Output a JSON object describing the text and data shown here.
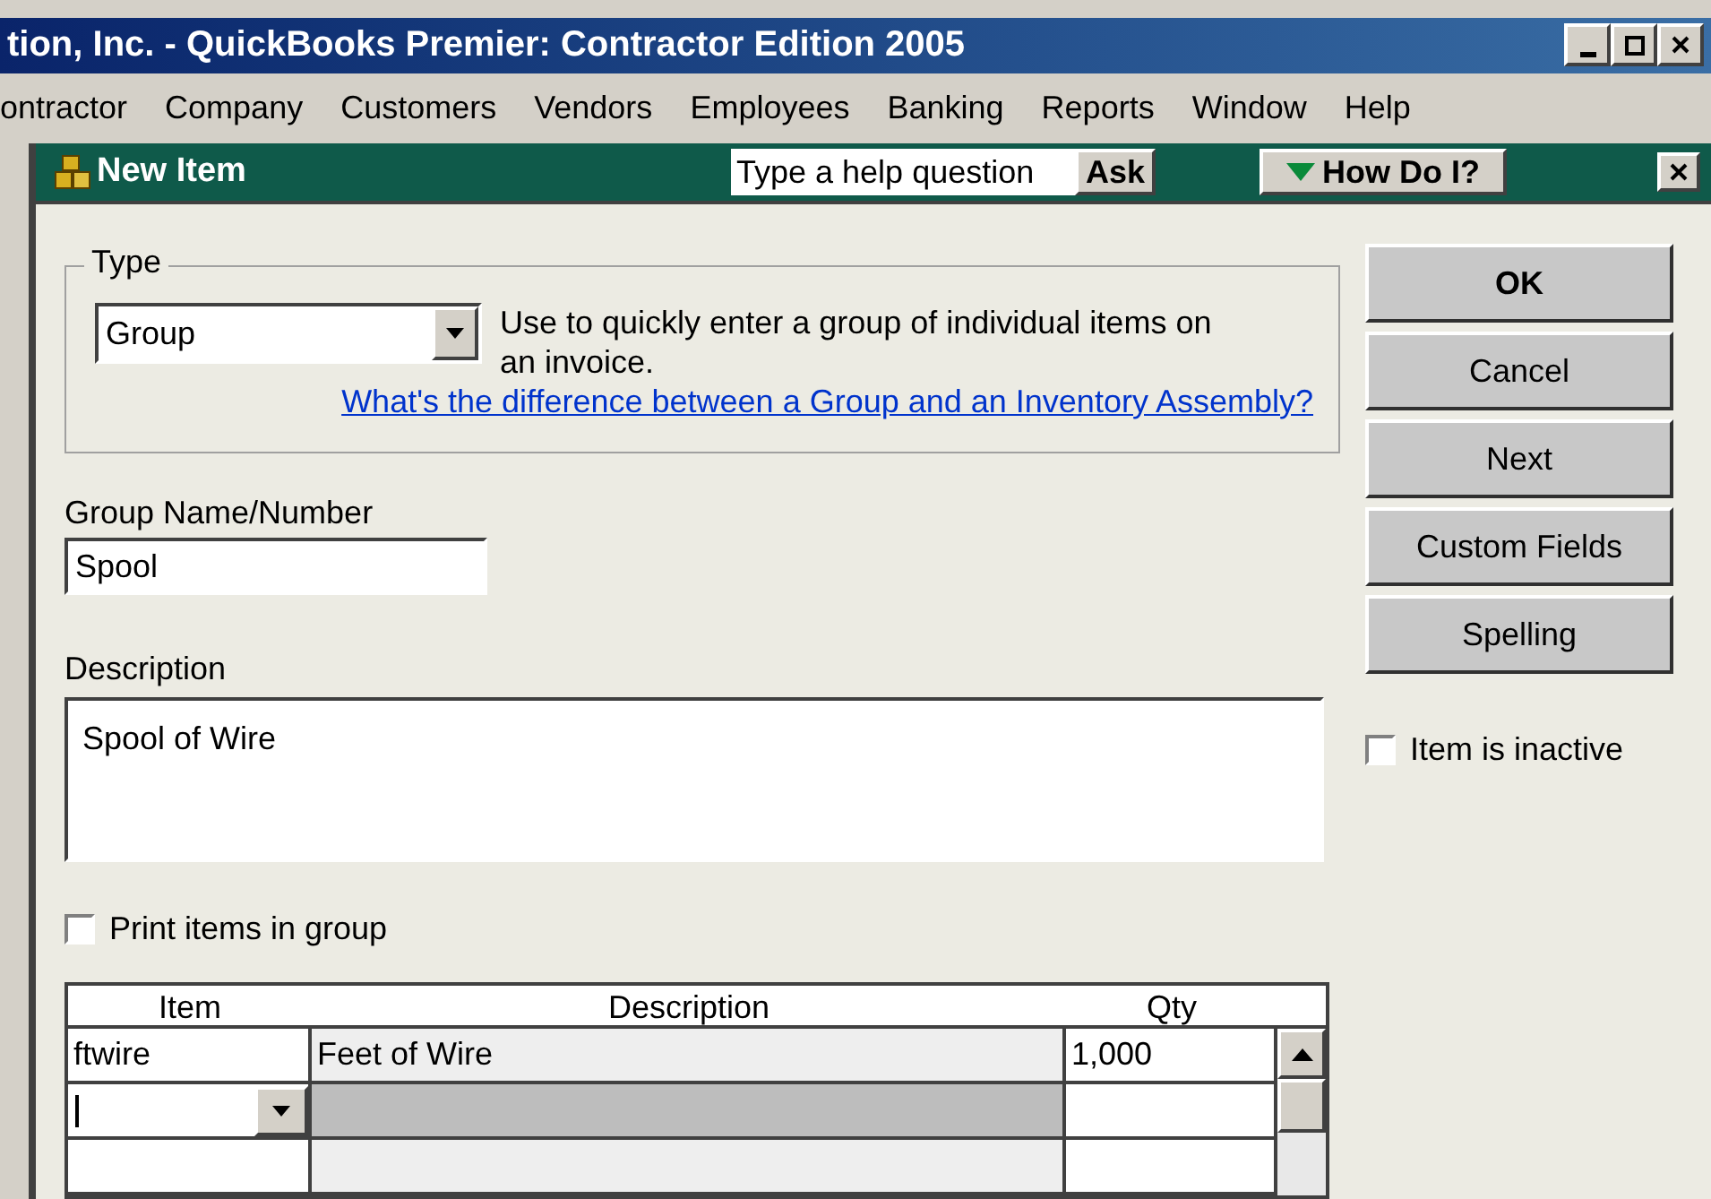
{
  "window": {
    "title": "tion, Inc. - QuickBooks Premier: Contractor Edition 2005"
  },
  "menu": [
    "ontractor",
    "Company",
    "Customers",
    "Vendors",
    "Employees",
    "Banking",
    "Reports",
    "Window",
    "Help"
  ],
  "dialog": {
    "title": "New Item",
    "help_search": {
      "placeholder": "Type a help question"
    },
    "ask_button": "Ask",
    "how_do_i": "How Do I?"
  },
  "type_group": {
    "label": "Type",
    "value": "Group",
    "hint": "Use to quickly enter a group of individual items on an invoice.",
    "link": "What's the difference between a Group and an Inventory Assembly?"
  },
  "name_field": {
    "label": "Group Name/Number",
    "value": "Spool"
  },
  "description_field": {
    "label": "Description",
    "value": "Spool of Wire"
  },
  "print_items": {
    "label": "Print items in group",
    "checked": false
  },
  "table": {
    "columns": [
      "Item",
      "Description",
      "Qty"
    ],
    "rows": [
      {
        "item": "ftwire",
        "description": "Feet of Wire",
        "qty": "1,000",
        "selected": false
      },
      {
        "item": "",
        "description": "",
        "qty": "",
        "selected": true
      },
      {
        "item": "",
        "description": "",
        "qty": "",
        "selected": false
      }
    ]
  },
  "buttons": [
    {
      "label": "OK",
      "default": true
    },
    {
      "label": "Cancel",
      "default": false
    },
    {
      "label": "Next",
      "default": false
    },
    {
      "label": "Custom Fields",
      "default": false
    },
    {
      "label": "Spelling",
      "default": false
    }
  ],
  "inactive": {
    "label": "Item is inactive",
    "checked": false
  }
}
